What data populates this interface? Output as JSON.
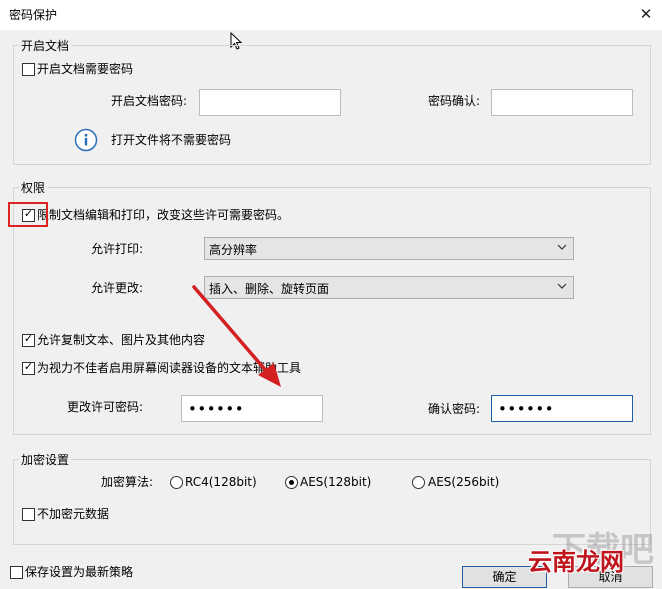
{
  "window": {
    "title": "密码保护",
    "close_glyph": "✕"
  },
  "open_doc": {
    "legend": "开启文档",
    "require_password_label": "开启文档需要密码",
    "require_password_checked": false,
    "password_label": "开启文档密码:",
    "password_value": "",
    "confirm_label": "密码确认:",
    "confirm_value": "",
    "info_text": "打开文件将不需要密码"
  },
  "permissions": {
    "legend": "权限",
    "restrict_label": "限制文档编辑和打印，改变这些许可需要密码。",
    "restrict_checked": true,
    "print_label": "允许打印:",
    "print_value": "高分辨率",
    "change_label": "允许更改:",
    "change_value": "插入、删除、旋转页面",
    "copy_label": "允许复制文本、图片及其他内容",
    "copy_checked": true,
    "screenreader_label": "为视力不佳者启用屏幕阅读器设备的文本辅助工具",
    "screenreader_checked": true,
    "change_pw_label": "更改许可密码:",
    "change_pw_value": "••••••",
    "confirm_pw_label": "确认密码:",
    "confirm_pw_value": "••••••"
  },
  "encryption": {
    "legend": "加密设置",
    "algo_label": "加密算法:",
    "options": [
      "RC4(128bit)",
      "AES(128bit)",
      "AES(256bit)"
    ],
    "selected": "AES(128bit)",
    "no_metadata_label": "不加密元数据",
    "no_metadata_checked": false
  },
  "footer": {
    "save_policy_label": "保存设置为最新策略",
    "save_policy_checked": false,
    "ok_label": "确定",
    "cancel_label": "取消"
  },
  "watermark": {
    "text": "云南龙网",
    "faint_text": "下载吧"
  },
  "colors": {
    "highlight": "#dd2222",
    "arrow": "#d42020",
    "accent": "#1f5fa8"
  },
  "icons": {
    "info": "info-icon",
    "chevron": "chevron-down-icon",
    "check": "✓",
    "cursor": "cursor-icon"
  }
}
